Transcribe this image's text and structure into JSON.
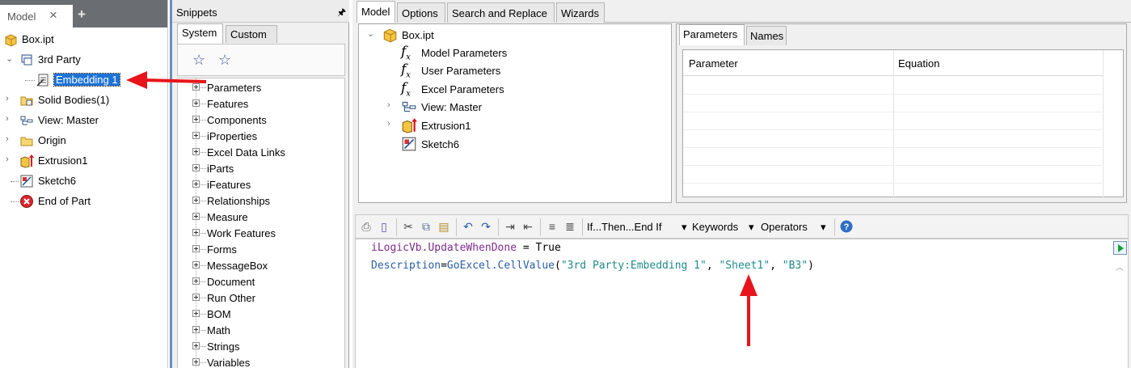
{
  "model_browser": {
    "tab_label": "Model",
    "close_glyph": "×",
    "add_glyph": "+",
    "tree": [
      {
        "label": "Box.ipt",
        "icon": "part-icon"
      },
      {
        "label": "3rd Party",
        "icon": "third-party-icon"
      },
      {
        "label": "Embedding 1",
        "icon": "embedding-icon",
        "selected": true
      },
      {
        "label": "Solid Bodies(1)",
        "icon": "solid-bodies-icon"
      },
      {
        "label": "View: Master",
        "icon": "view-icon"
      },
      {
        "label": "Origin",
        "icon": "folder-icon"
      },
      {
        "label": "Extrusion1",
        "icon": "extrusion-icon"
      },
      {
        "label": "Sketch6",
        "icon": "sketch-icon"
      },
      {
        "label": "End of Part",
        "icon": "end-of-part-icon"
      }
    ]
  },
  "snippets": {
    "title": "Snippets",
    "pin_glyph": "🖈",
    "tabs": [
      "System",
      "Custom"
    ],
    "items": [
      "Parameters",
      "Features",
      "Components",
      "iProperties",
      "Excel Data Links",
      "iParts",
      "iFeatures",
      "Relationships",
      "Measure",
      "Work Features",
      "Forms",
      "MessageBox",
      "Document",
      "Run Other",
      "BOM",
      "Math",
      "Strings",
      "Variables"
    ]
  },
  "editor": {
    "tabs": [
      "Model",
      "Options",
      "Search and Replace",
      "Wizards"
    ],
    "model_tree": [
      {
        "label": "Box.ipt"
      },
      {
        "label": "Model Parameters"
      },
      {
        "label": "User Parameters"
      },
      {
        "label": "Excel Parameters"
      },
      {
        "label": "View: Master"
      },
      {
        "label": "Extrusion1"
      },
      {
        "label": "Sketch6"
      }
    ],
    "fx_glyph": "f",
    "fx_sub": "x",
    "params_tabs": [
      "Parameters",
      "Names"
    ],
    "params_columns": [
      "Parameter",
      "Equation"
    ],
    "toolbar": {
      "if_then": "If...Then...End If",
      "keywords": "Keywords",
      "operators": "Operators",
      "dropdown_glyph": "▾"
    },
    "code": {
      "line1_obj": "iLogicVb",
      "line1_member": ".UpdateWhenDone",
      "line1_rest": " = True",
      "line2_target": "Description",
      "line2_eq": "=",
      "line2_call": "GoExcel.CellValue",
      "line2_open": "(",
      "line2_arg1": "\"3rd Party:Embedding 1\"",
      "line2_sep1": ", ",
      "line2_arg2": "\"Sheet1\"",
      "line2_sep2": ", ",
      "line2_arg3": "\"B3\"",
      "line2_close": ")"
    }
  },
  "colors": {
    "selection": "#1e73d6",
    "annotation_arrow": "#e8141b",
    "keyword_purple": "#7d2c8c",
    "member_blue": "#2b5fa6",
    "string_teal": "#1f8b8b"
  }
}
